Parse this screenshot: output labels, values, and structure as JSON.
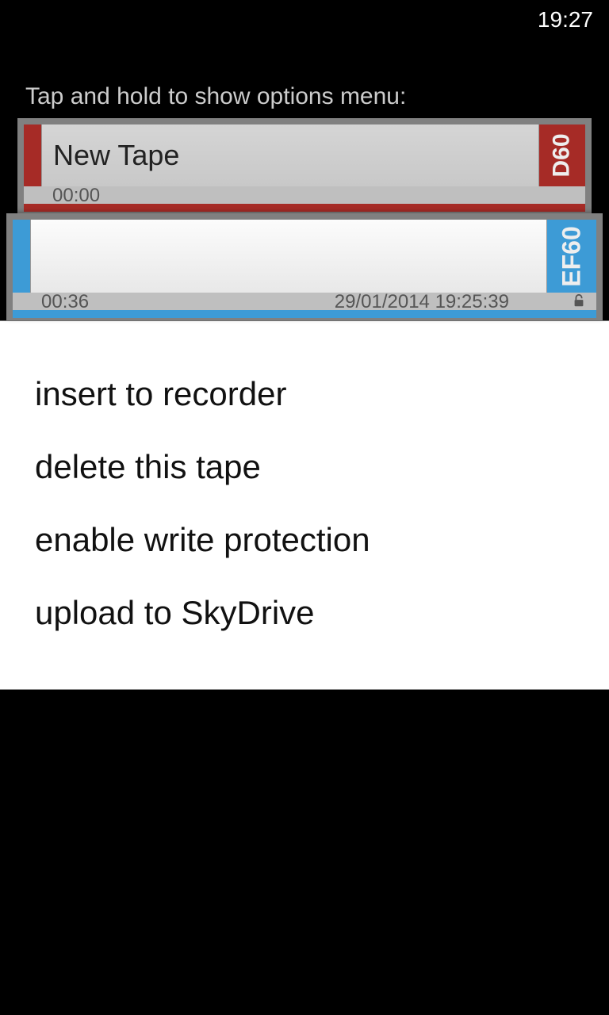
{
  "status": {
    "time": "19:27"
  },
  "instruction_label": "Tap and hold to show options menu:",
  "tapes": [
    {
      "name": "New Tape",
      "duration": "00:00",
      "datetime": "",
      "type_label": "D60",
      "accent": "#a62b26"
    },
    {
      "name": "",
      "duration": "00:36",
      "datetime": "29/01/2014 19:25:39",
      "type_label": "EF60",
      "accent": "#3d9bd6"
    }
  ],
  "context_menu": {
    "items": [
      "insert to recorder",
      "delete this tape",
      "enable write protection",
      "upload to SkyDrive"
    ]
  }
}
